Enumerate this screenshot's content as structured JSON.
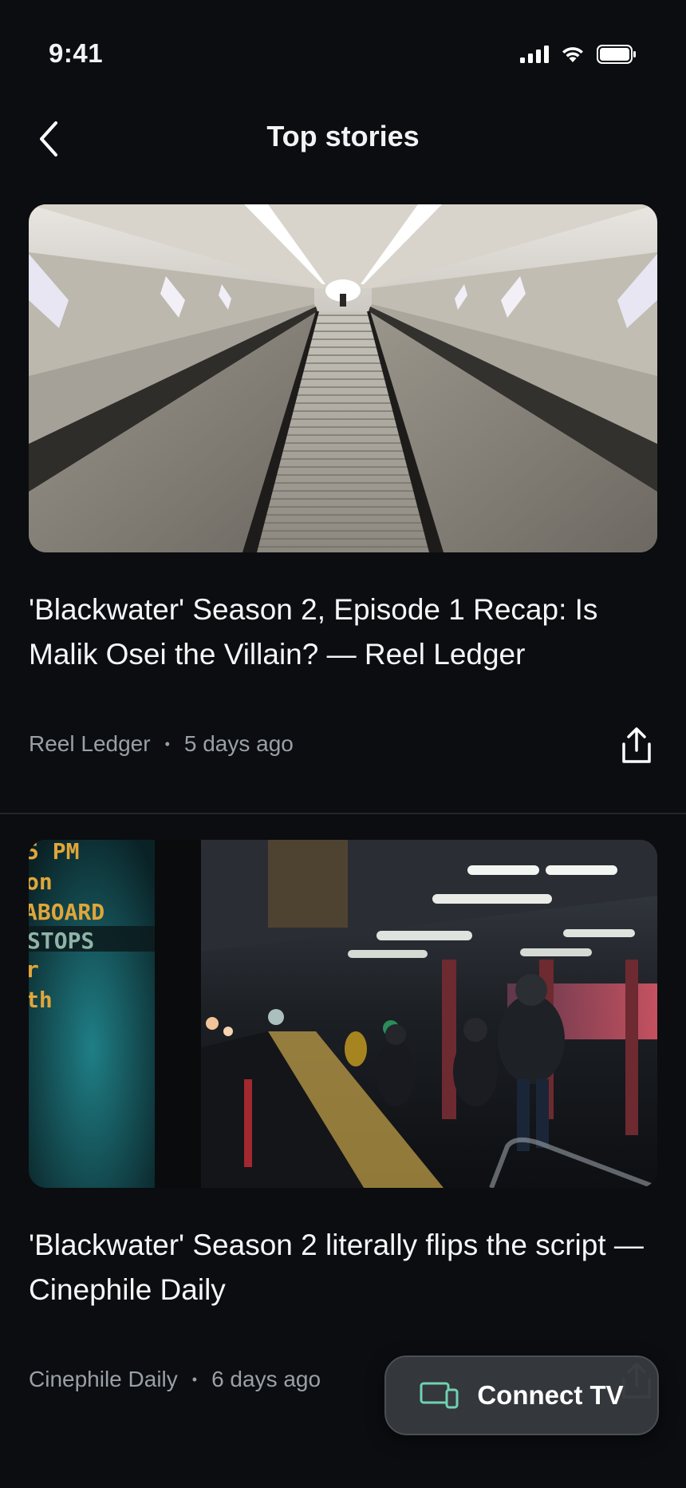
{
  "status": {
    "time": "9:41"
  },
  "nav": {
    "title": "Top stories"
  },
  "stories": [
    {
      "headline": "'Blackwater' Season 2, Episode 1 Recap: Is Malik Osei the Villain? — Reel Ledger",
      "source": "Reel Ledger",
      "age": "5 days ago",
      "image": "escalator-tunnel-photo"
    },
    {
      "headline": "'Blackwater' Season 2 literally flips the script — Cinephile Daily",
      "source": "Cinephile Daily",
      "age": "6 days ago",
      "image": "subway-platform-photo",
      "sign_lines": [
        "5 PM",
        "on",
        "ABOARD",
        "STOPS",
        "r",
        "th"
      ]
    }
  ],
  "connect_tv": {
    "label": "Connect TV",
    "icon": "devices-icon"
  },
  "colors": {
    "background": "#0b0d10",
    "text": "#f2f3f5",
    "meta": "#9aa0a6",
    "sign": "#e0a63a"
  }
}
